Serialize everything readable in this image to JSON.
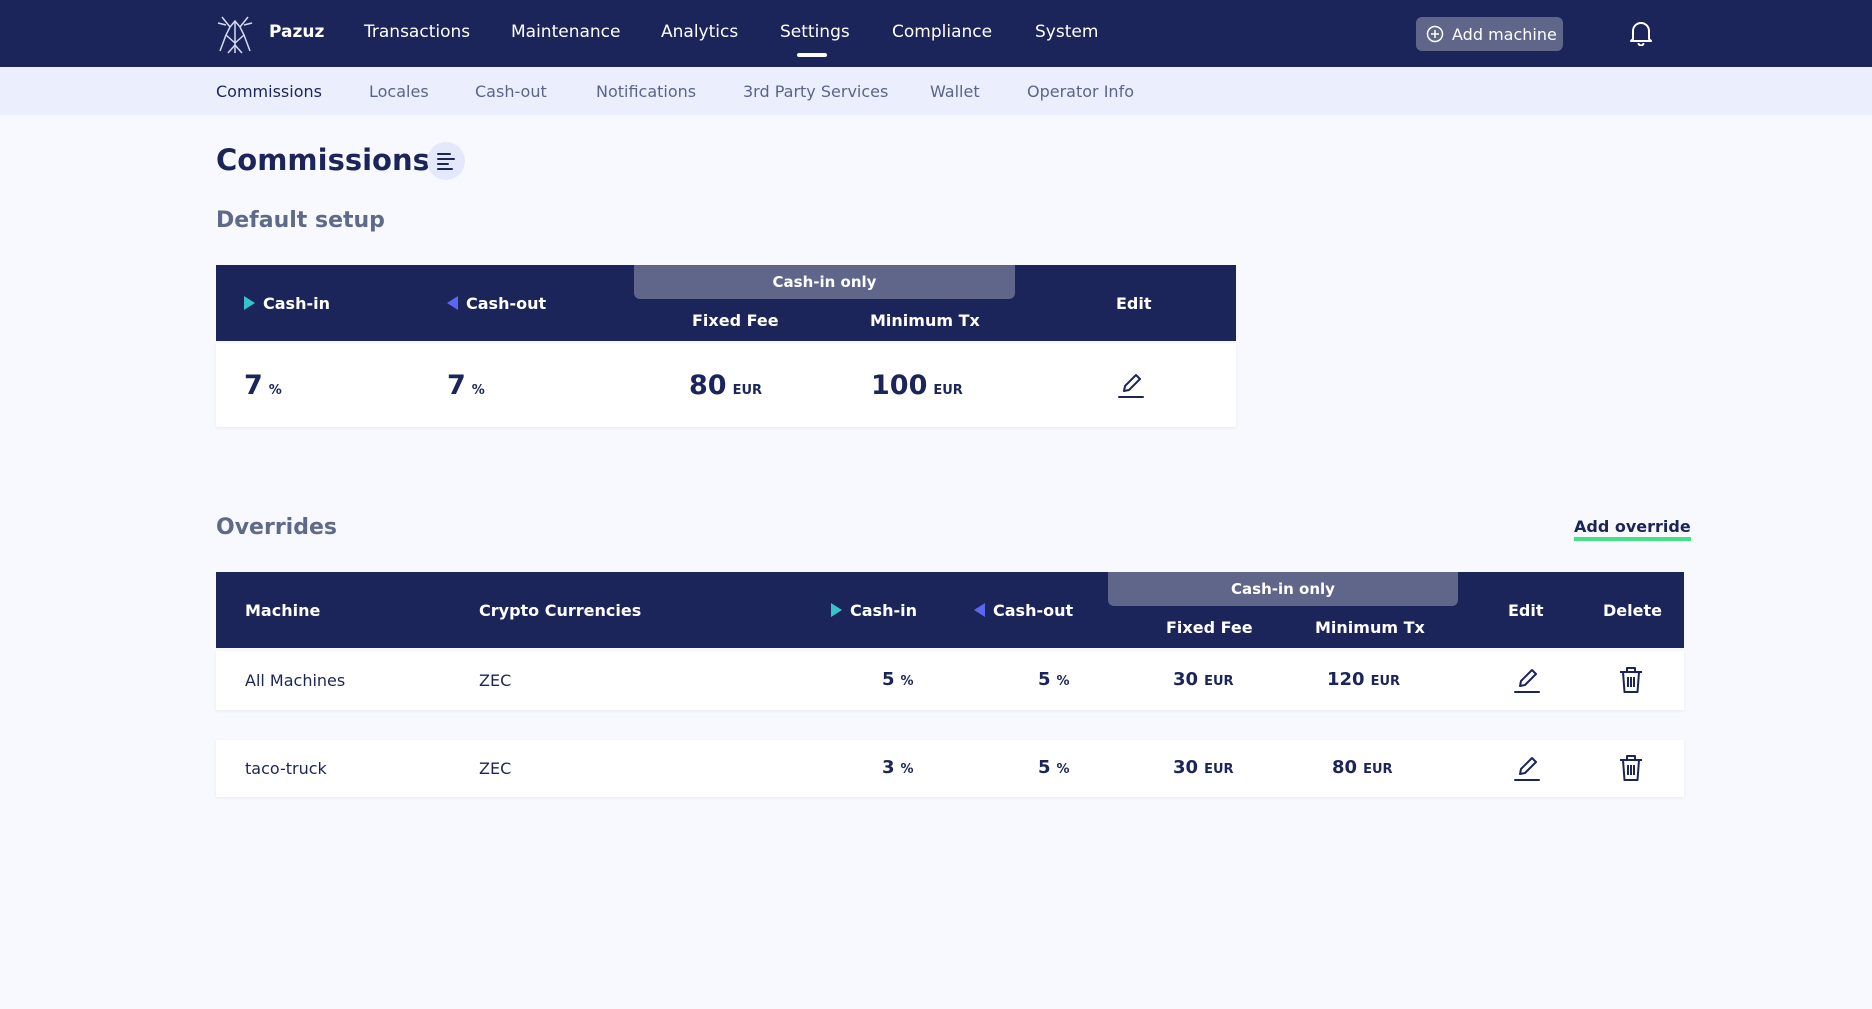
{
  "brand": {
    "name": "Pazuz"
  },
  "nav": {
    "items": [
      "Transactions",
      "Maintenance",
      "Analytics",
      "Settings",
      "Compliance",
      "System"
    ],
    "active": "Settings",
    "add_machine_label": "Add machine"
  },
  "subnav": {
    "items": [
      "Commissions",
      "Locales",
      "Cash-out",
      "Notifications",
      "3rd Party Services",
      "Wallet",
      "Operator Info"
    ],
    "active": "Commissions"
  },
  "page": {
    "title": "Commissions"
  },
  "default_setup": {
    "title": "Default setup",
    "headers": {
      "cash_in": "Cash-in",
      "cash_out": "Cash-out",
      "cash_in_only": "Cash-in only",
      "fixed_fee": "Fixed Fee",
      "minimum_tx": "Minimum Tx",
      "edit": "Edit"
    },
    "row": {
      "cash_in": "7",
      "cash_in_unit": "%",
      "cash_out": "7",
      "cash_out_unit": "%",
      "fixed_fee": "80",
      "fixed_fee_unit": "EUR",
      "minimum_tx": "100",
      "minimum_tx_unit": "EUR"
    }
  },
  "overrides": {
    "title": "Overrides",
    "add_label": "Add override",
    "headers": {
      "machine": "Machine",
      "crypto": "Crypto Currencies",
      "cash_in": "Cash-in",
      "cash_out": "Cash-out",
      "cash_in_only": "Cash-in only",
      "fixed_fee": "Fixed Fee",
      "minimum_tx": "Minimum Tx",
      "edit": "Edit",
      "delete": "Delete"
    },
    "rows": [
      {
        "machine": "All Machines",
        "crypto": "ZEC",
        "cash_in": "5",
        "cash_in_unit": "%",
        "cash_out": "5",
        "cash_out_unit": "%",
        "fixed_fee": "30",
        "fixed_fee_unit": "EUR",
        "minimum_tx": "120",
        "minimum_tx_unit": "EUR"
      },
      {
        "machine": "taco-truck",
        "crypto": "ZEC",
        "cash_in": "3",
        "cash_in_unit": "%",
        "cash_out": "5",
        "cash_out_unit": "%",
        "fixed_fee": "30",
        "fixed_fee_unit": "EUR",
        "minimum_tx": "80",
        "minimum_tx_unit": "EUR"
      }
    ]
  },
  "colors": {
    "navy": "#1b2559",
    "cash_in_arrow": "#36c4c8",
    "cash_out_arrow": "#5a67f3",
    "accent_underline": "#44e188"
  }
}
